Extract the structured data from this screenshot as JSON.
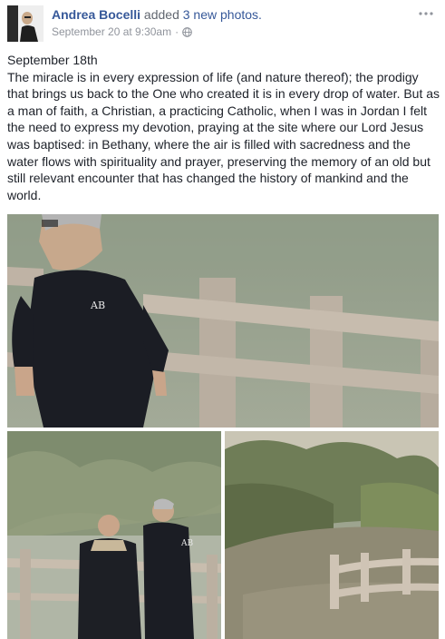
{
  "post": {
    "author": "Andrea Bocelli",
    "action": "added",
    "photo_count": "3 new photos.",
    "timestamp": "September 20 at 9:30am",
    "separator": "·",
    "privacy_icon": "globe-icon",
    "menu_icon": "more-options-icon",
    "text_date": "September 18th",
    "text_body": "The miracle is in every expression of life (and nature thereof); the prodigy that brings us back to the One who created it is in every drop of water. But as a man of faith, a Christian, a practicing Catholic, when I was in Jordan I felt the need to express my devotion, praying at the site where our Lord Jesus was baptised: in Bethany, where the air is filled with sacredness and the water flows with spirituality and prayer, preserving the memory of an old but still relevant encounter that has changed the history of mankind and the world."
  },
  "photos": [
    {
      "shirt_logo": "AB"
    },
    {
      "shirt_logo": "AB"
    },
    {}
  ],
  "colors": {
    "link": "#365899",
    "text": "#1d2129",
    "meta": "#90949c"
  }
}
